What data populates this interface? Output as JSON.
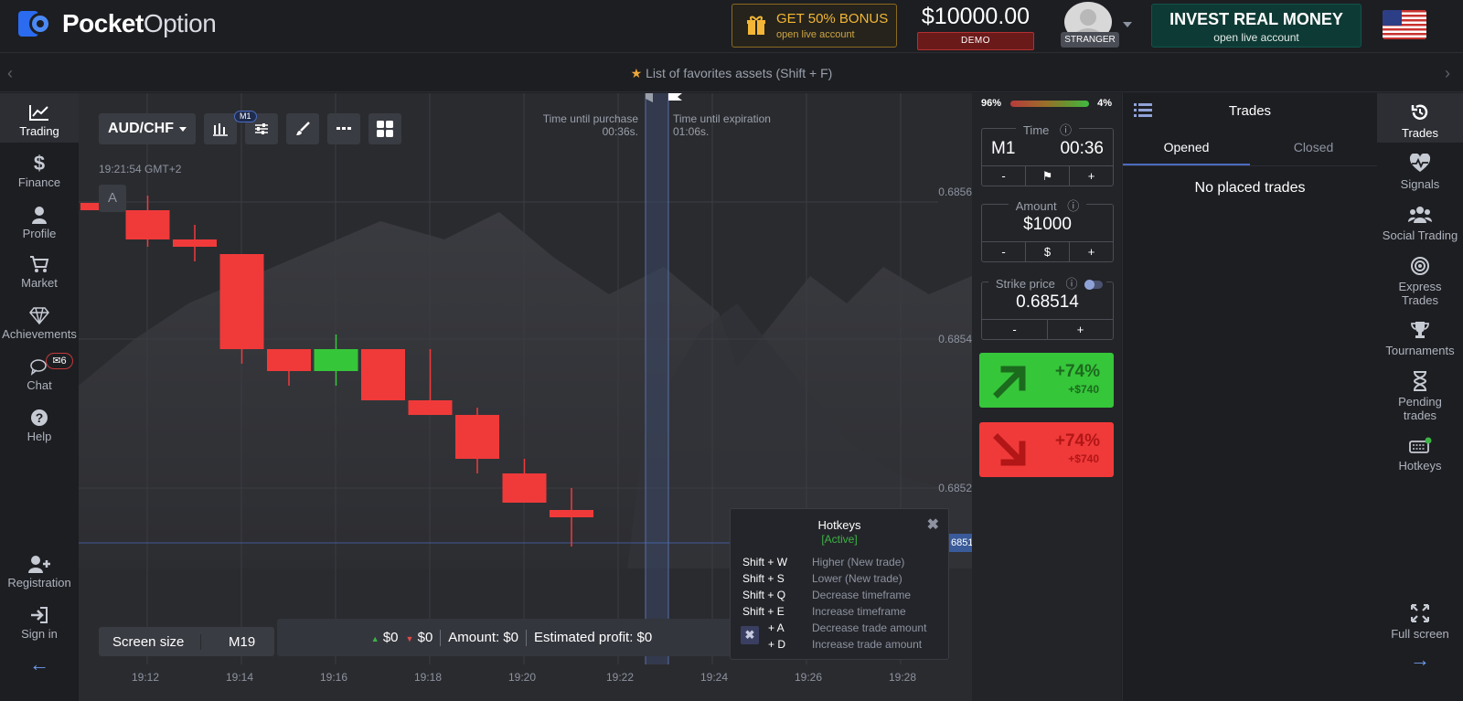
{
  "header": {
    "logo_bold": "Pocket",
    "logo_light": "Option",
    "bonus_title": "GET 50% BONUS",
    "bonus_sub": "open live account",
    "balance": "$10000.00",
    "account_type": "DEMO",
    "user_label": "STRANGER",
    "invest_title": "INVEST REAL MONEY",
    "invest_sub": "open live account"
  },
  "favorites_bar": {
    "label": "List of favorites assets (Shift + F)"
  },
  "left_nav": {
    "items": [
      {
        "label": "Trading",
        "icon": "chart-line-icon"
      },
      {
        "label": "Finance",
        "icon": "dollar-icon"
      },
      {
        "label": "Profile",
        "icon": "user-icon"
      },
      {
        "label": "Market",
        "icon": "cart-icon"
      },
      {
        "label": "Achievements",
        "icon": "diamond-icon"
      },
      {
        "label": "Chat",
        "icon": "chat-icon"
      },
      {
        "label": "Help",
        "icon": "help-icon"
      }
    ],
    "chat_badge": "6",
    "registration": "Registration",
    "sign_in": "Sign in"
  },
  "chart": {
    "asset": "AUD/CHF",
    "timeframe_tag": "M1",
    "clock": "19:21:54 GMT+2",
    "a_button": "A",
    "purchase_label": "Time until purchase",
    "purchase_time": "00:36s.",
    "expiration_label": "Time until expiration",
    "expiration_time": "01:06s.",
    "price_labels": [
      "0.6856",
      "0.6854",
      "0.6852"
    ],
    "current_price_tag": "6851",
    "x_labels": [
      "19:12",
      "19:14",
      "19:16",
      "19:18",
      "19:20",
      "19:22",
      "19:24",
      "19:26",
      "19:28"
    ]
  },
  "chart_data": {
    "type": "candlestick",
    "candles": [
      {
        "dir": "down",
        "open": 0.6856,
        "close": 0.68559,
        "high": 0.6856,
        "low": 0.68559
      },
      {
        "dir": "down",
        "open": 0.68559,
        "close": 0.68555,
        "high": 0.68561,
        "low": 0.68554
      },
      {
        "dir": "down",
        "open": 0.68555,
        "close": 0.68554,
        "high": 0.68557,
        "low": 0.68552
      },
      {
        "dir": "down",
        "open": 0.68553,
        "close": 0.6854,
        "high": 0.68553,
        "low": 0.68538
      },
      {
        "dir": "down",
        "open": 0.6854,
        "close": 0.68537,
        "high": 0.6854,
        "low": 0.68535
      },
      {
        "dir": "up",
        "open": 0.68537,
        "close": 0.6854,
        "high": 0.68542,
        "low": 0.68535
      },
      {
        "dir": "down",
        "open": 0.6854,
        "close": 0.68533,
        "high": 0.6854,
        "low": 0.68533
      },
      {
        "dir": "down",
        "open": 0.68533,
        "close": 0.68531,
        "high": 0.6854,
        "low": 0.68531
      },
      {
        "dir": "down",
        "open": 0.68531,
        "close": 0.68525,
        "high": 0.68532,
        "low": 0.68523
      },
      {
        "dir": "down",
        "open": 0.68523,
        "close": 0.68519,
        "high": 0.68525,
        "low": 0.68519
      },
      {
        "dir": "down",
        "open": 0.68518,
        "close": 0.68517,
        "high": 0.68521,
        "low": 0.68513
      }
    ],
    "y_ticks": [
      0.6856,
      0.6854,
      0.6852
    ],
    "current_price": 0.68514
  },
  "hotkeys": {
    "title": "Hotkeys",
    "status": "[Active]",
    "rows": [
      {
        "key": "Shift + W",
        "desc": "Higher (New trade)"
      },
      {
        "key": "Shift + S",
        "desc": "Lower (New trade)"
      },
      {
        "key": "Shift + Q",
        "desc": "Decrease timeframe"
      },
      {
        "key": "Shift + E",
        "desc": "Increase timeframe"
      },
      {
        "key": "+ A",
        "desc": "Decrease trade amount"
      },
      {
        "key": "+ D",
        "desc": "Increase trade amount"
      }
    ]
  },
  "bottom_bar": {
    "screen_size": "Screen size",
    "timeframe": "M19",
    "up_amount": "$0",
    "down_amount": "$0",
    "amount": "Amount: $0",
    "profit": "Estimated profit: $0"
  },
  "trade_panel": {
    "sentiment_left": "96%",
    "sentiment_right": "4%",
    "time_label": "Time",
    "time_frame": "M1",
    "time_value": "00:36",
    "amount_label": "Amount",
    "amount_value": "$1000",
    "amount_mid": "$",
    "strike_label": "Strike price",
    "strike_value": "0.68514",
    "minus": "-",
    "plus": "+",
    "up_pct": "+74%",
    "up_amt": "+$740",
    "down_pct": "+74%",
    "down_amt": "+$740"
  },
  "trades_panel": {
    "title": "Trades",
    "tab_opened": "Opened",
    "tab_closed": "Closed",
    "empty": "No placed trades"
  },
  "right_nav": {
    "items": [
      {
        "label": "Trades"
      },
      {
        "label": "Signals"
      },
      {
        "label": "Social Trading"
      },
      {
        "label": "Express Trades"
      },
      {
        "label": "Tournaments"
      },
      {
        "label": "Pending trades"
      },
      {
        "label": "Hotkeys"
      },
      {
        "label": "Full screen"
      }
    ]
  },
  "colors": {
    "up": "#36c63a",
    "down": "#f03a3a",
    "accent_blue": "#4b6cc1"
  }
}
